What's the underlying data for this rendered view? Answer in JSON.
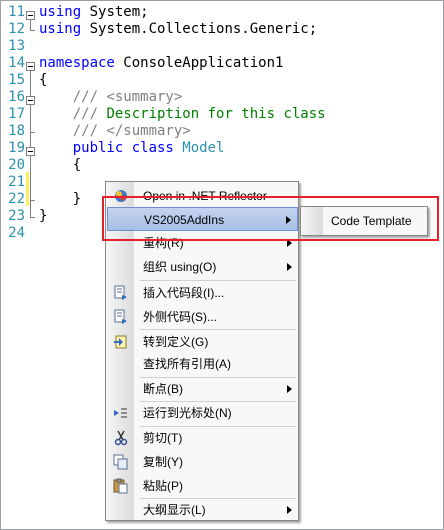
{
  "editor": {
    "lines": [
      {
        "num": "11",
        "parts": [
          {
            "c": "kw",
            "t": "using"
          },
          {
            "c": "tx",
            "t": " System;"
          }
        ]
      },
      {
        "num": "12",
        "parts": [
          {
            "c": "kw",
            "t": "using"
          },
          {
            "c": "tx",
            "t": " System.Collections.Generic;"
          }
        ]
      },
      {
        "num": "13",
        "parts": []
      },
      {
        "num": "14",
        "parts": [
          {
            "c": "kw",
            "t": "namespace"
          },
          {
            "c": "tx",
            "t": " ConsoleApplication1"
          }
        ]
      },
      {
        "num": "15",
        "parts": [
          {
            "c": "tx",
            "t": "{"
          }
        ]
      },
      {
        "num": "16",
        "parts": [
          {
            "c": "xml",
            "t": "    /// <summary>"
          }
        ]
      },
      {
        "num": "17",
        "parts": [
          {
            "c": "xml",
            "t": "    ///"
          },
          {
            "c": "cm",
            "t": " Description for this class"
          }
        ]
      },
      {
        "num": "18",
        "parts": [
          {
            "c": "xml",
            "t": "    /// </summary>"
          }
        ]
      },
      {
        "num": "19",
        "parts": [
          {
            "c": "kw",
            "t": "    public class"
          },
          {
            "c": "tx",
            "t": " "
          },
          {
            "c": "tp",
            "t": "Model"
          }
        ]
      },
      {
        "num": "20",
        "parts": [
          {
            "c": "tx",
            "t": "    {"
          }
        ]
      },
      {
        "num": "21",
        "parts": []
      },
      {
        "num": "22",
        "parts": [
          {
            "c": "tx",
            "t": "    }"
          }
        ]
      },
      {
        "num": "23",
        "parts": [
          {
            "c": "tx",
            "t": "}"
          }
        ]
      },
      {
        "num": "24",
        "parts": []
      }
    ]
  },
  "context_menu": {
    "items": [
      {
        "label": "Open in .NET Reflector",
        "icon": "reflector-icon",
        "submenu": false
      },
      {
        "label": "VS2005AddIns",
        "icon": "",
        "submenu": true,
        "highlighted": true
      },
      {
        "label": "重构(R)",
        "icon": "",
        "submenu": true
      },
      {
        "label": "组织 using(O)",
        "icon": "",
        "submenu": true
      },
      {
        "label": "插入代码段(I)...",
        "icon": "insert-snippet-icon",
        "submenu": false
      },
      {
        "label": "外侧代码(S)...",
        "icon": "surround-with-icon",
        "submenu": false
      },
      {
        "label": "转到定义(G)",
        "icon": "go-to-definition-icon",
        "submenu": false
      },
      {
        "label": "查找所有引用(A)",
        "icon": "",
        "submenu": false
      },
      {
        "label": "断点(B)",
        "icon": "",
        "submenu": true
      },
      {
        "label": "运行到光标处(N)",
        "icon": "run-to-cursor-icon",
        "submenu": false
      },
      {
        "label": "剪切(T)",
        "icon": "cut-icon",
        "submenu": false
      },
      {
        "label": "复制(Y)",
        "icon": "copy-icon",
        "submenu": false
      },
      {
        "label": "粘贴(P)",
        "icon": "paste-icon",
        "submenu": false
      },
      {
        "label": "大纲显示(L)",
        "icon": "",
        "submenu": true
      }
    ]
  },
  "submenu": {
    "items": [
      {
        "label": "Code Template"
      }
    ]
  },
  "colors": {
    "keyword": "#0000ff",
    "comment": "#008000",
    "xml_doc": "#808080",
    "type_name": "#2b91af",
    "line_number": "#2b91af",
    "highlight_box": "#e8202a"
  }
}
